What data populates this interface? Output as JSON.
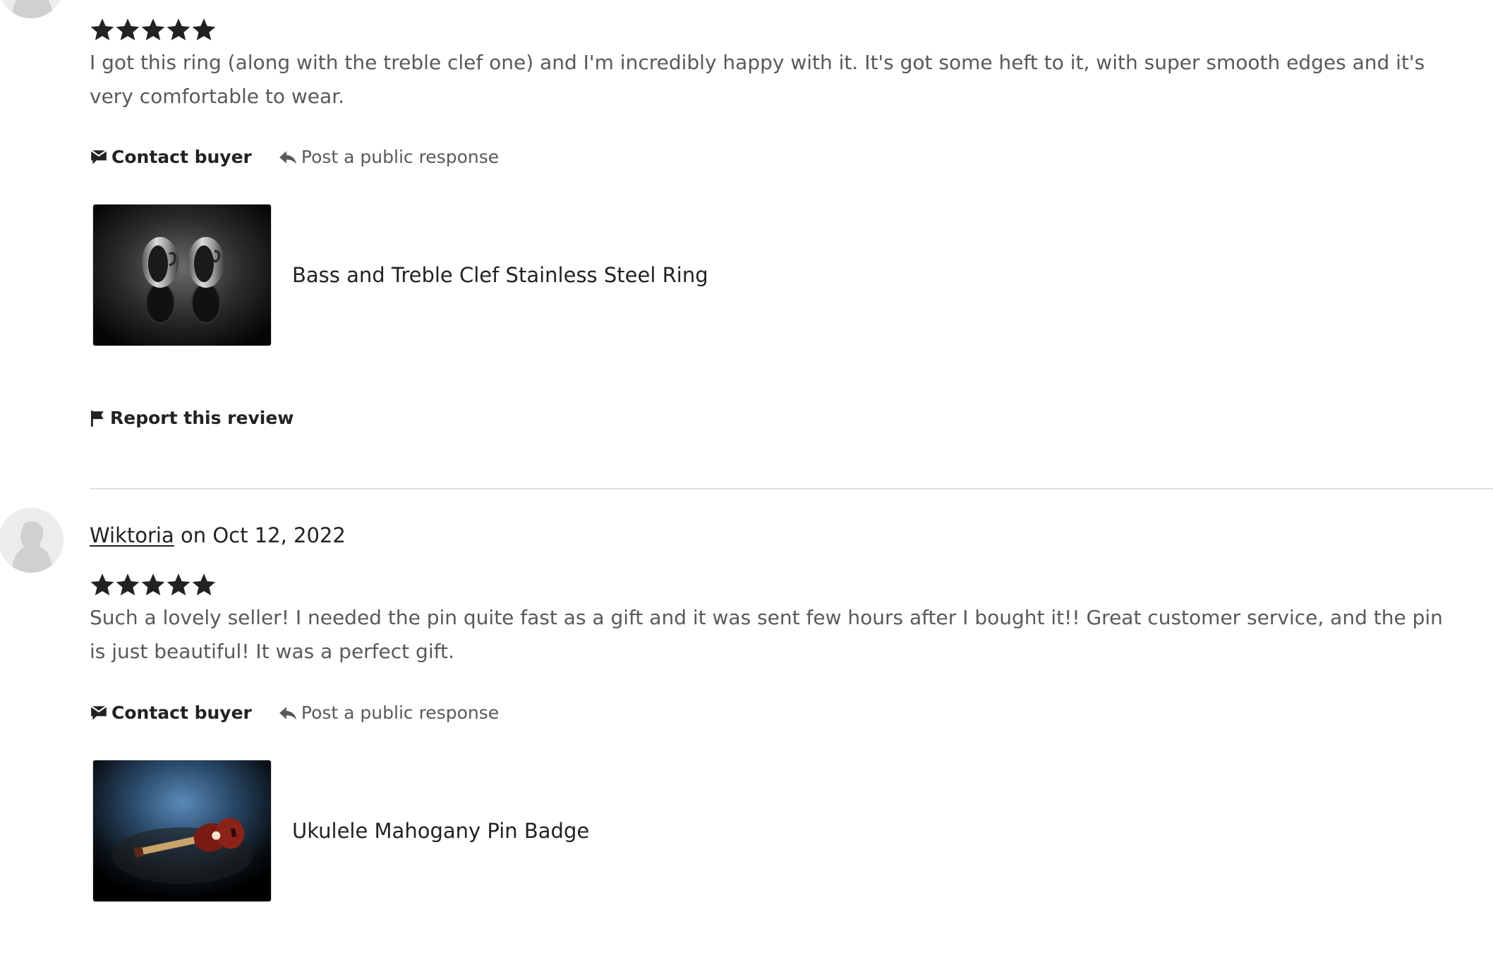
{
  "reviews": [
    {
      "reviewer": "",
      "date_text": "",
      "rating": 5,
      "text": "I got this ring (along with the treble clef one) and I'm incredibly happy with it. It's got some heft to it, with super smooth edges and it's very comfortable to wear.",
      "contact_label": "Contact buyer",
      "response_label": "Post a public response",
      "product_title": "Bass and Treble Clef Stainless Steel Ring",
      "report_label": "Report this review"
    },
    {
      "reviewer": "Wiktoria",
      "date_text": " on Oct 12, 2022",
      "rating": 5,
      "text": "Such a lovely seller! I needed the pin quite fast as a gift and it was sent few hours after I bought it!! Great customer service, and the pin is just beautiful! It was a perfect gift.",
      "contact_label": "Contact buyer",
      "response_label": "Post a public response",
      "product_title": "Ukulele Mahogany Pin Badge"
    }
  ],
  "icons": {
    "star": "star-icon",
    "contact": "chat-bubble-icon",
    "response": "reply-arrow-icon",
    "report": "flag-icon",
    "avatar": "person-silhouette-icon"
  },
  "colors": {
    "text_primary": "#222222",
    "text_secondary": "#595959",
    "divider": "#e1e1e1",
    "avatar_bg": "#ececec"
  }
}
